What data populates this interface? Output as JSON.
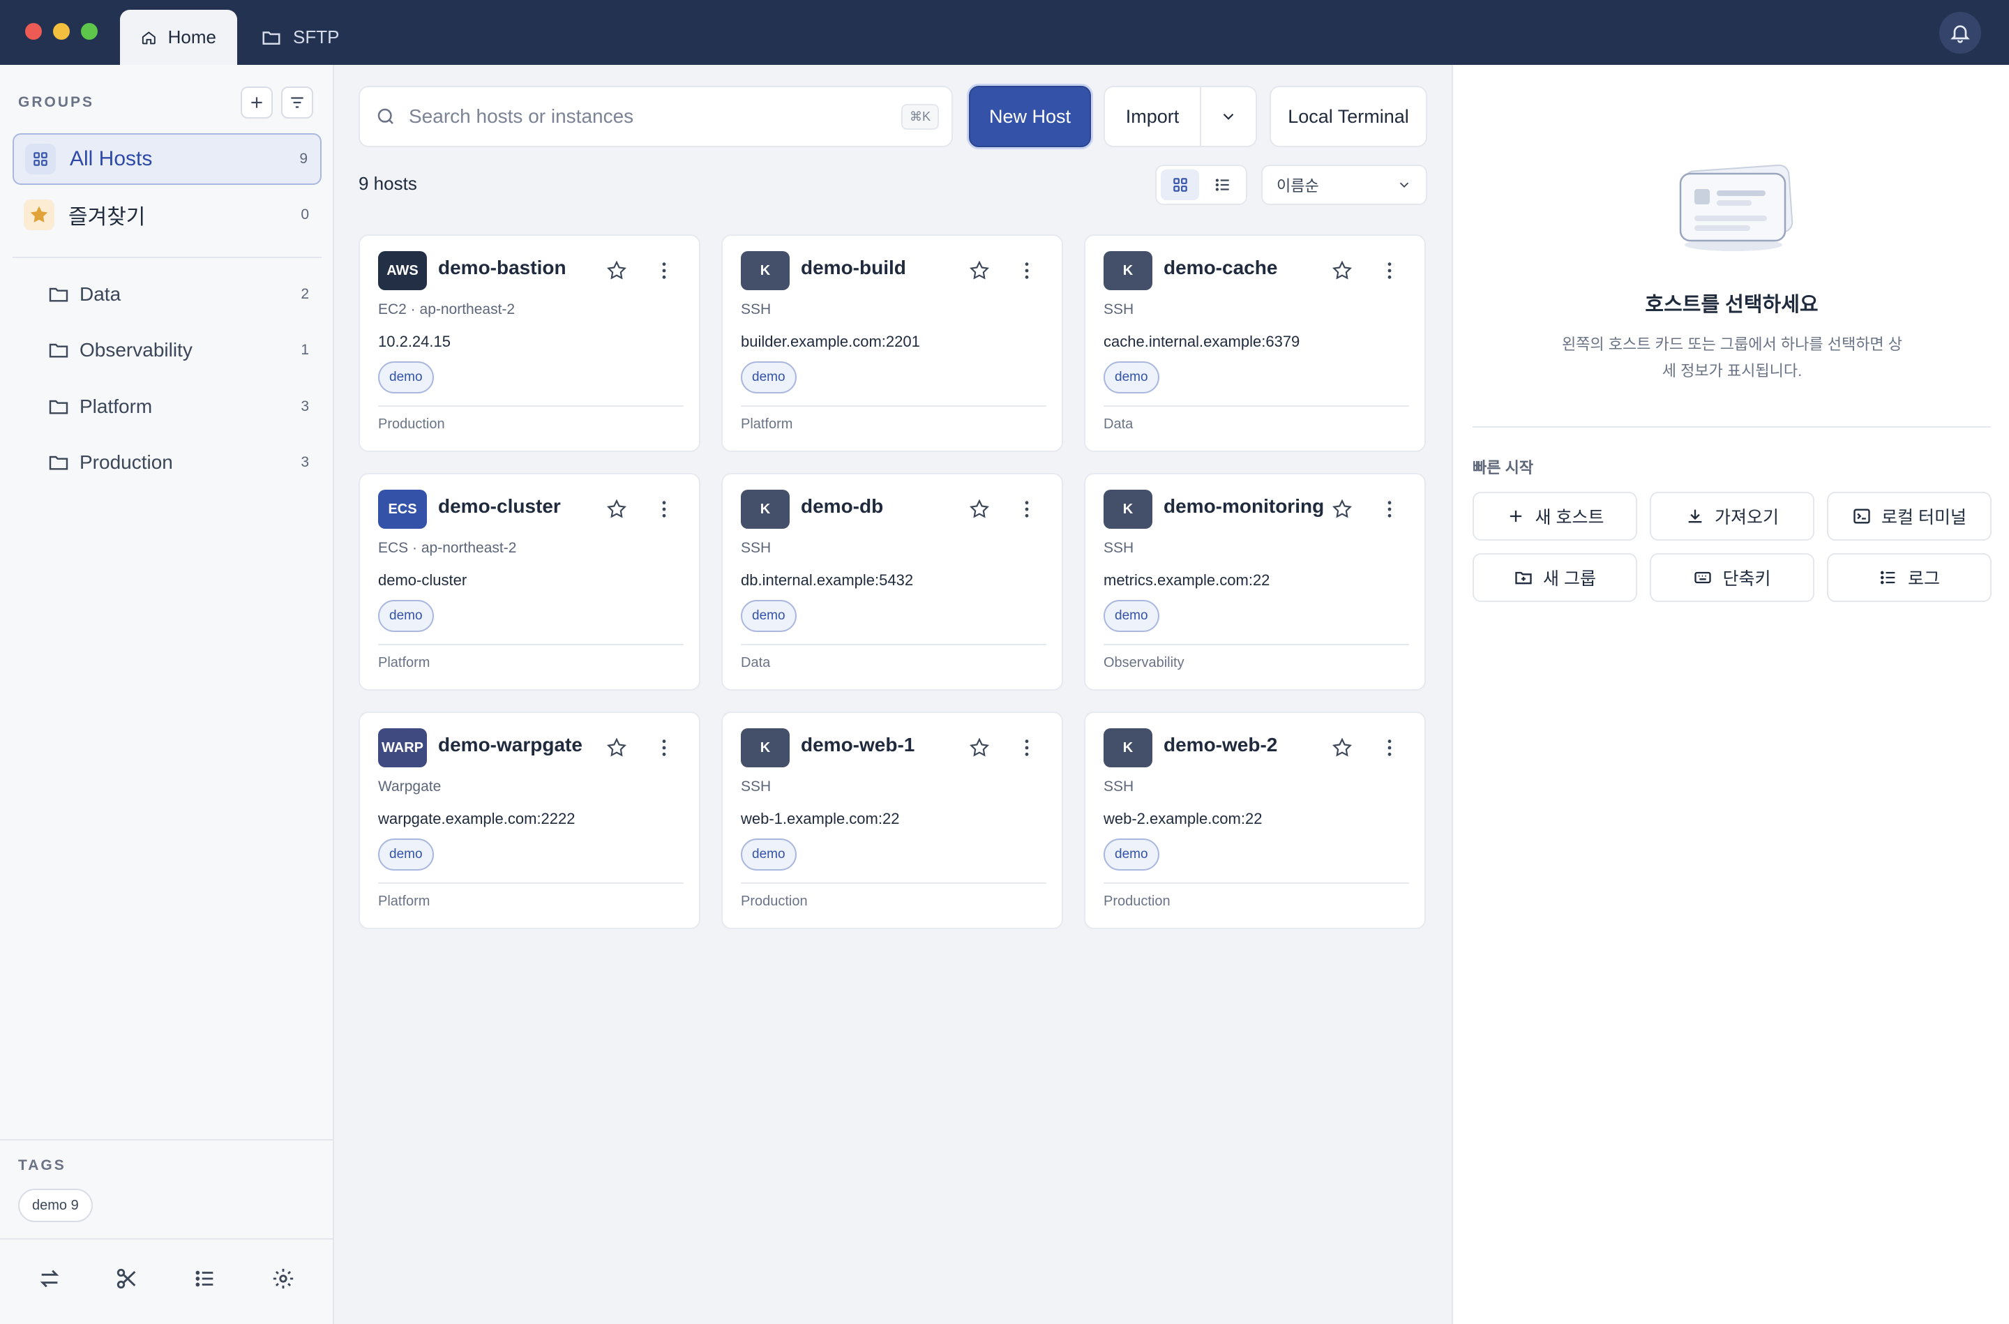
{
  "tabs": [
    {
      "label": "Home",
      "icon": "home-icon"
    },
    {
      "label": "SFTP",
      "icon": "folder-icon"
    }
  ],
  "sidebar": {
    "groups_label": "GROUPS",
    "nav": [
      {
        "label": "All Hosts",
        "count": "9"
      },
      {
        "label": "즐겨찾기",
        "count": "0"
      }
    ],
    "folders": [
      {
        "label": "Data",
        "count": "2"
      },
      {
        "label": "Observability",
        "count": "1"
      },
      {
        "label": "Platform",
        "count": "3"
      },
      {
        "label": "Production",
        "count": "3"
      }
    ],
    "tags_label": "TAGS",
    "tags": [
      {
        "label": "demo 9"
      }
    ]
  },
  "toolbar": {
    "search_placeholder": "Search hosts or instances",
    "search_shortcut": "⌘K",
    "new_host": "New Host",
    "import": "Import",
    "local_terminal": "Local Terminal",
    "host_count": "9 hosts",
    "sort": "이름순"
  },
  "hosts": [
    {
      "badge": "AWS",
      "name": "demo-bastion",
      "type": "EC2 · ap-northeast-2",
      "address": "10.2.24.15",
      "tag": "demo",
      "group": "Production"
    },
    {
      "badge": "K",
      "name": "demo-build",
      "type": "SSH",
      "address": "builder.example.com:2201",
      "tag": "demo",
      "group": "Platform"
    },
    {
      "badge": "K",
      "name": "demo-cache",
      "type": "SSH",
      "address": "cache.internal.example:6379",
      "tag": "demo",
      "group": "Data"
    },
    {
      "badge": "ECS",
      "name": "demo-cluster",
      "type": "ECS · ap-northeast-2",
      "address": "demo-cluster",
      "tag": "demo",
      "group": "Platform"
    },
    {
      "badge": "K",
      "name": "demo-db",
      "type": "SSH",
      "address": "db.internal.example:5432",
      "tag": "demo",
      "group": "Data"
    },
    {
      "badge": "K",
      "name": "demo-monitoring",
      "type": "SSH",
      "address": "metrics.example.com:22",
      "tag": "demo",
      "group": "Observability"
    },
    {
      "badge": "WARP",
      "name": "demo-warpgate",
      "type": "Warpgate",
      "address": "warpgate.example.com:2222",
      "tag": "demo",
      "group": "Platform"
    },
    {
      "badge": "K",
      "name": "demo-web-1",
      "type": "SSH",
      "address": "web-1.example.com:22",
      "tag": "demo",
      "group": "Production"
    },
    {
      "badge": "K",
      "name": "demo-web-2",
      "type": "SSH",
      "address": "web-2.example.com:22",
      "tag": "demo",
      "group": "Production"
    }
  ],
  "detail": {
    "title": "호스트를 선택하세요",
    "description": "왼쪽의 호스트 카드 또는 그룹에서 하나를 선택하면 상세 정보가 표시됩니다.",
    "quick_start_label": "빠른 시작",
    "quick_start": [
      {
        "label": "새 호스트",
        "icon": "plus-icon"
      },
      {
        "label": "가져오기",
        "icon": "download-icon"
      },
      {
        "label": "로컬 터미널",
        "icon": "terminal-icon"
      },
      {
        "label": "새 그룹",
        "icon": "folder-plus-icon"
      },
      {
        "label": "단축키",
        "icon": "keyboard-icon"
      },
      {
        "label": "로그",
        "icon": "list-icon"
      }
    ]
  },
  "colors": {
    "titlebar": "#243252",
    "accent": "#3453a8",
    "favorite": "#e0a33a"
  }
}
